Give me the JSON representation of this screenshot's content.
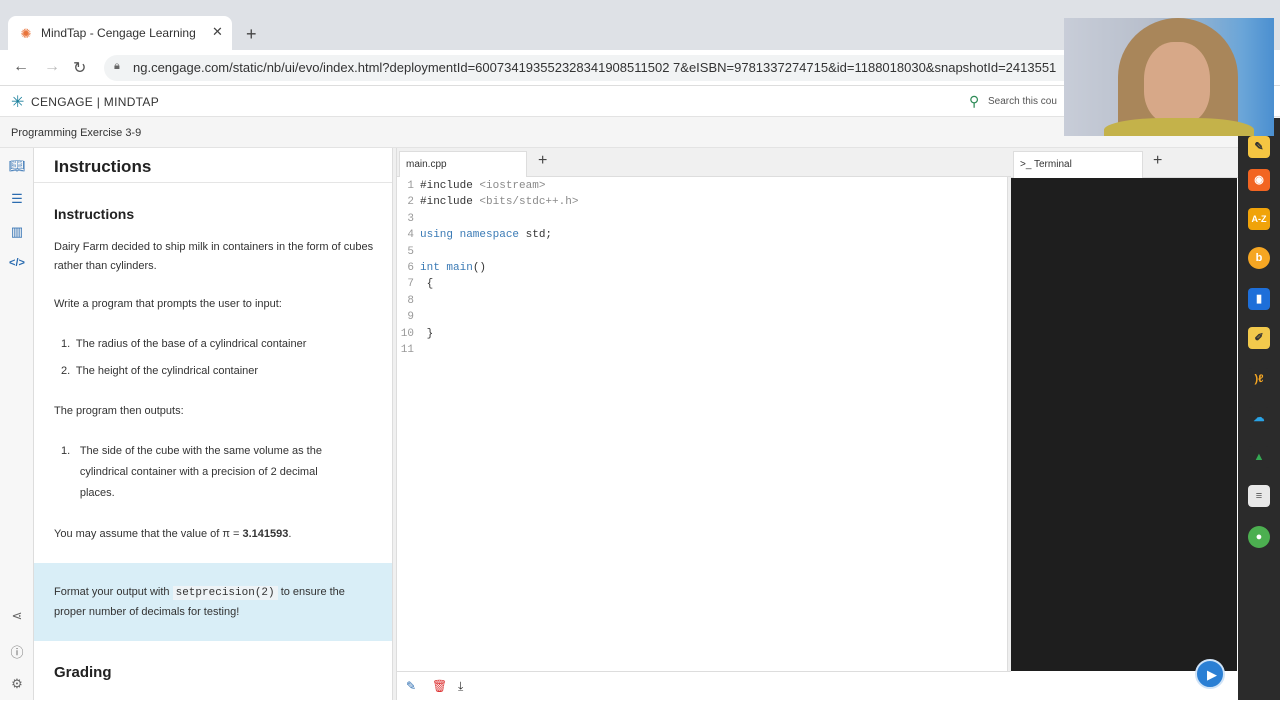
{
  "browser": {
    "tab_title": "MindTap - Cengage Learning",
    "tab_close": "✕",
    "new_tab": "+",
    "url": "ng.cengage.com/static/nb/ui/evo/index.html?deploymentId=600734193552328341908511502 7&eISBN=9781337274715&id=1188018030&snapshotId=2413551"
  },
  "header": {
    "brand": "CENGAGE | MINDTAP",
    "search_placeholder": "Search this cou"
  },
  "breadcrumb": "Programming Exercise 3-9",
  "instructions": {
    "panel_title": "Instructions",
    "heading": "Instructions",
    "p1": "Dairy Farm decided to ship milk in containers in the form of cubes rather than cylinders.",
    "p2": "Write a program that prompts the user to input:",
    "inputs": [
      {
        "num": "1.",
        "text": "The radius of the base of a cylindrical container"
      },
      {
        "num": "2.",
        "text": "The height of the cylindrical container"
      }
    ],
    "p3": "The program then outputs:",
    "outputs": [
      {
        "num": "1.",
        "text": "The side of the cube with the same volume as the cylindrical container with a precision of 2 decimal places."
      }
    ],
    "pi_prefix": "You may assume that the value of π = ",
    "pi_value": "3.141593",
    "pi_suffix": ".",
    "tip_prefix": "Format your output with ",
    "tip_code": "setprecision(2)",
    "tip_suffix": " to ensure the proper number of decimals for testing!",
    "grading": "Grading"
  },
  "editor": {
    "tab_label": "main.cpp",
    "add": "+",
    "line_numbers": [
      "1",
      "2",
      "3",
      "4",
      "5",
      "6",
      "7",
      "8",
      "9",
      "10",
      "11"
    ],
    "lines": [
      {
        "a": "#include ",
        "b": "<iostream>",
        "c": ""
      },
      {
        "a": "#include ",
        "b": "<bits/stdc++.h>",
        "c": ""
      },
      {
        "a": "",
        "b": "",
        "c": ""
      },
      {
        "a": "using ",
        "b": "namespace",
        "c": " std;"
      },
      {
        "a": "",
        "b": "",
        "c": ""
      },
      {
        "a": "int ",
        "b": "main",
        "c": "()"
      },
      {
        "a": " {",
        "b": "",
        "c": ""
      },
      {
        "a": "",
        "b": "",
        "c": ""
      },
      {
        "a": "",
        "b": "",
        "c": ""
      },
      {
        "a": " }",
        "b": "",
        "c": ""
      },
      {
        "a": "",
        "b": "",
        "c": ""
      }
    ]
  },
  "terminal": {
    "tab_label": ">_ Terminal",
    "add": "+"
  },
  "dock_labels": [
    "A-Z"
  ],
  "colors": {
    "accent": "#2b6cb0",
    "tip_bg": "#d9eef7",
    "terminal_bg": "#1e1e1e",
    "dock_bg": "#2b2b2b"
  }
}
